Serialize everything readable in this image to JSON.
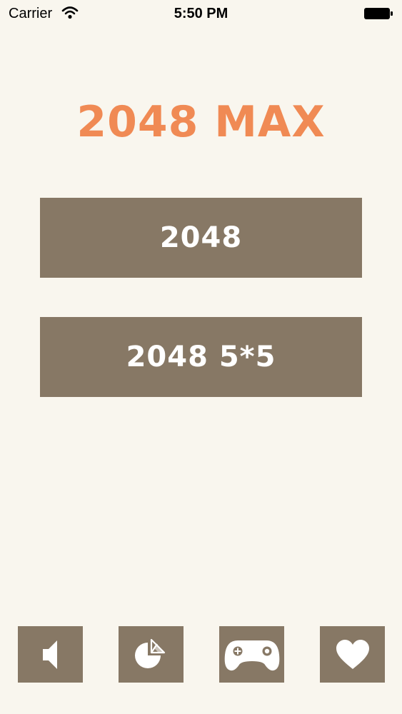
{
  "status_bar": {
    "carrier": "Carrier",
    "time": "5:50 PM"
  },
  "title": "2048 MAX",
  "menu": {
    "classic_label": "2048",
    "five_by_five_label": "2048 5*5"
  },
  "bottom_bar": {
    "icons": [
      "speaker-icon",
      "pie-chart-icon",
      "gamepad-icon",
      "heart-icon"
    ]
  },
  "colors": {
    "background": "#f9f6ee",
    "title": "#f08a54",
    "button": "#877865",
    "button_text": "#ffffff"
  }
}
